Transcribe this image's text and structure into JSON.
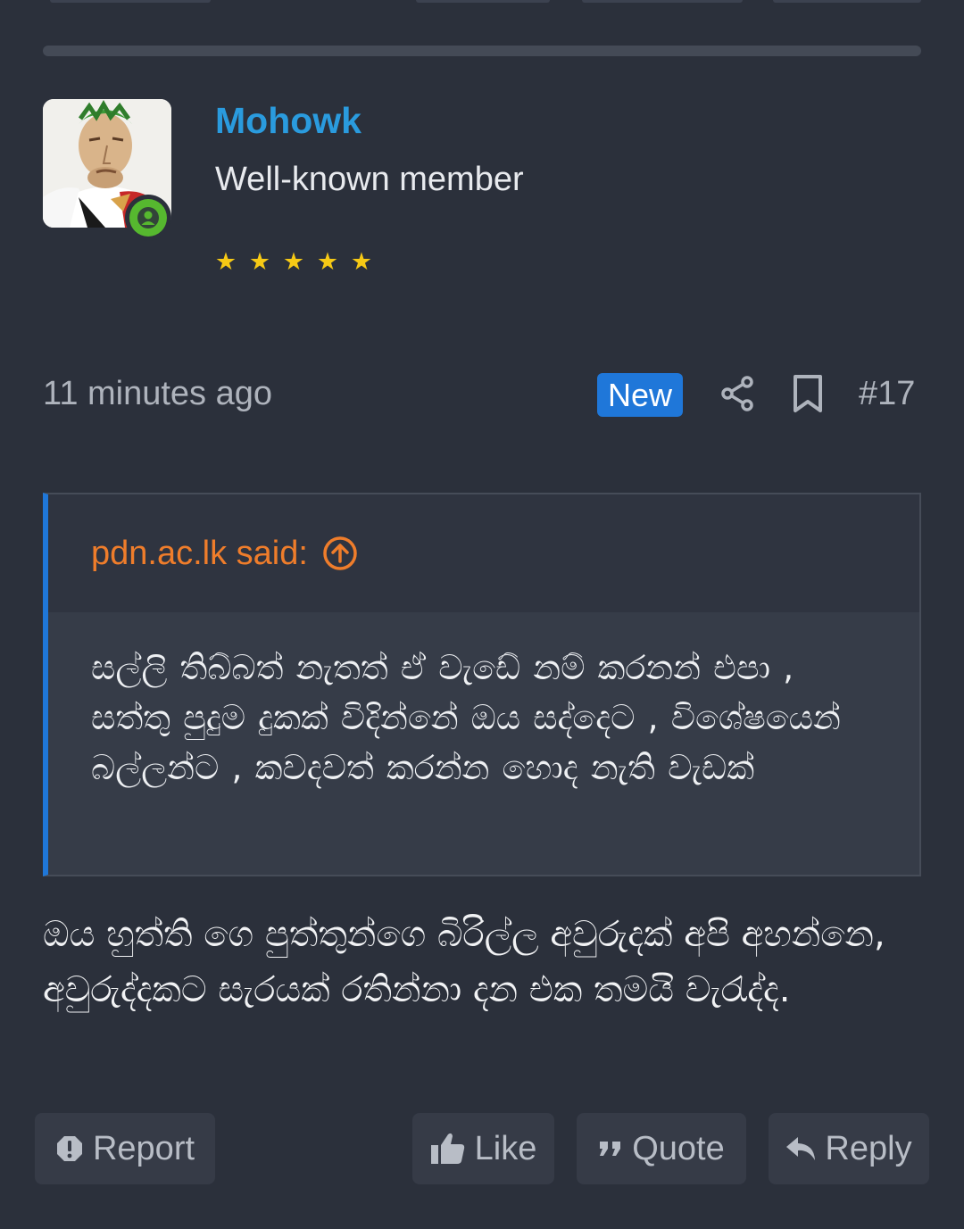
{
  "post": {
    "user": {
      "name": "Mohowk",
      "title": "Well-known member",
      "stars": [
        "★",
        "★",
        "★",
        "★",
        "★"
      ],
      "avatar_icon": "avatar-cartoon-man",
      "status_icon": "online-user-icon"
    },
    "meta": {
      "time": "11 minutes ago",
      "new_badge": "New",
      "share_icon": "share-icon",
      "bookmark_icon": "bookmark-icon",
      "number": "#17"
    },
    "quote": {
      "author": "pdn.ac.lk said:",
      "jump_icon": "arrow-up-circle-icon",
      "text": "සල්ලි තිබ්බත් නැතත් ඒ වැඩේ නම් කරනන් එපා , සත්තු පුදුම දුකක් විදින්නේ ඔය සද්දෙට , විශේෂයෙන් බල්ලන්ට , කවදවත් කරන්න හොද නැති වැඩක්"
    },
    "message": "ඔය හුත්ති ගෙ පුත්තුන්ගෙ බිරිල්ල අවුරුදක් අපි අහන්නෙ, අවුරුද්දකට සැරයක් රතින්නා දන එක තමයි වැරැද්ද.",
    "actions": {
      "report": "Report",
      "like": "Like",
      "quote": "Quote",
      "reply": "Reply"
    }
  },
  "colors": {
    "background": "#2b303b",
    "username": "#2a9bde",
    "quote_author": "#ef7d2b",
    "accent": "#1f77d9",
    "stars": "#f6c915",
    "online": "#56b82f"
  }
}
